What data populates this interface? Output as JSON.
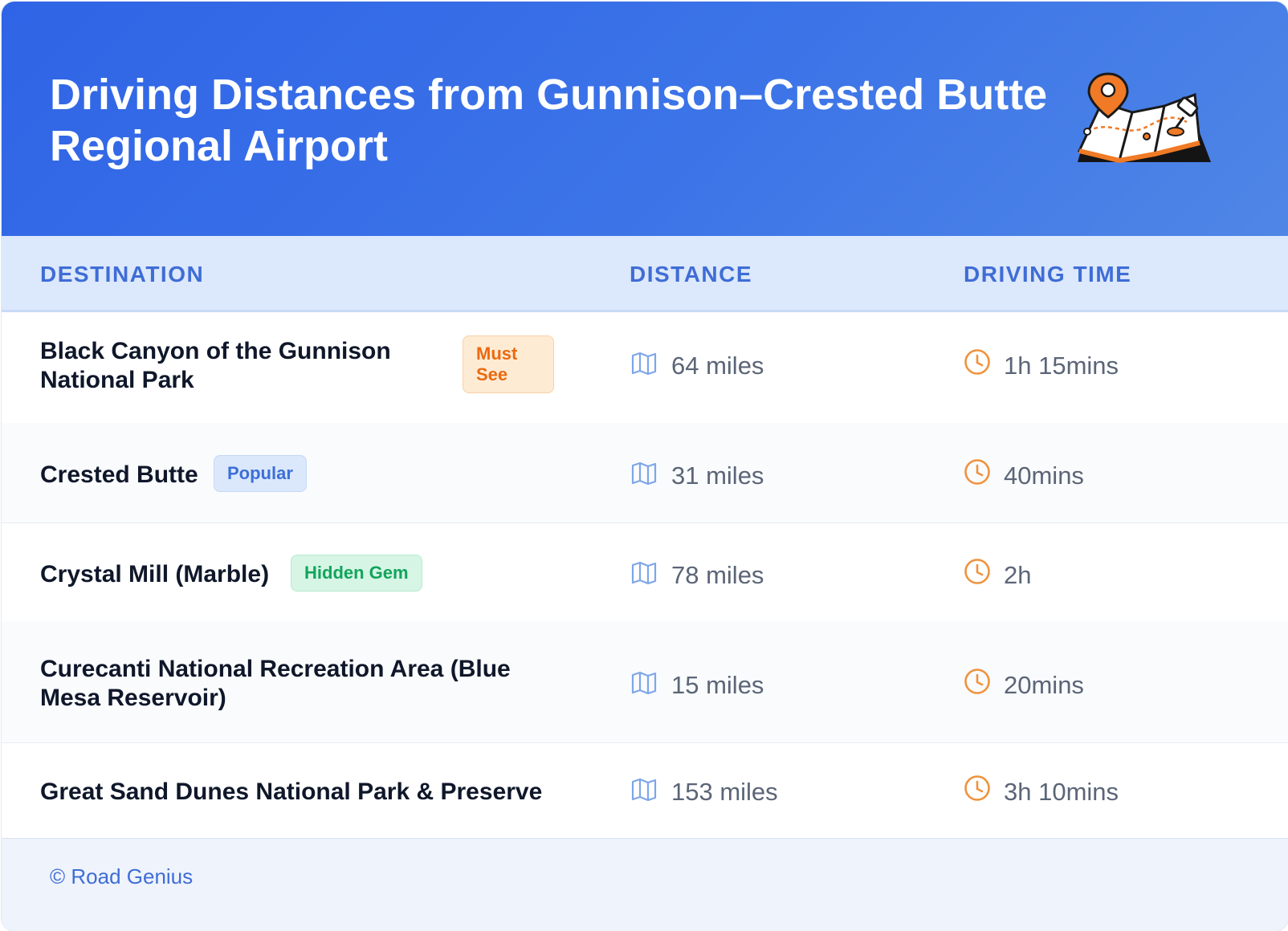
{
  "header": {
    "title": "Driving Distances from Gunnison–Crested Butte Regional Airport",
    "illustration_icon": "folded-map-with-pin-icon"
  },
  "table": {
    "columns": [
      "DESTINATION",
      "DISTANCE",
      "DRIVING TIME"
    ],
    "distance_icon": "map-icon",
    "time_icon": "clock-icon",
    "rows": [
      {
        "destination": "Black Canyon of the Gunnison National Park",
        "badge": "Must See",
        "badge_color": "#ea6a10",
        "distance": "64 miles",
        "time": "1h 15mins"
      },
      {
        "destination": "Crested Butte",
        "badge": "Popular",
        "badge_color": "#3d6fd8",
        "distance": "31 miles",
        "time": "40mins"
      },
      {
        "destination": "Crystal Mill (Marble)",
        "badge": "Hidden Gem",
        "badge_color": "#12a45c",
        "distance": "78 miles",
        "time": "2h"
      },
      {
        "destination": "Curecanti National Recreation Area (Blue Mesa Reservoir)",
        "badge": "",
        "distance": "15 miles",
        "time": "20mins"
      },
      {
        "destination": "Great Sand Dunes National Park & Preserve",
        "badge": "",
        "distance": "153 miles",
        "time": "3h 10mins"
      }
    ]
  },
  "footer": {
    "text": "© Road Genius"
  },
  "colors": {
    "header_blue": "#2f64e6",
    "accent_blue": "#3f6dd6",
    "icon_orange": "#f0923c",
    "map_icon_blue": "#7ea6e8"
  }
}
